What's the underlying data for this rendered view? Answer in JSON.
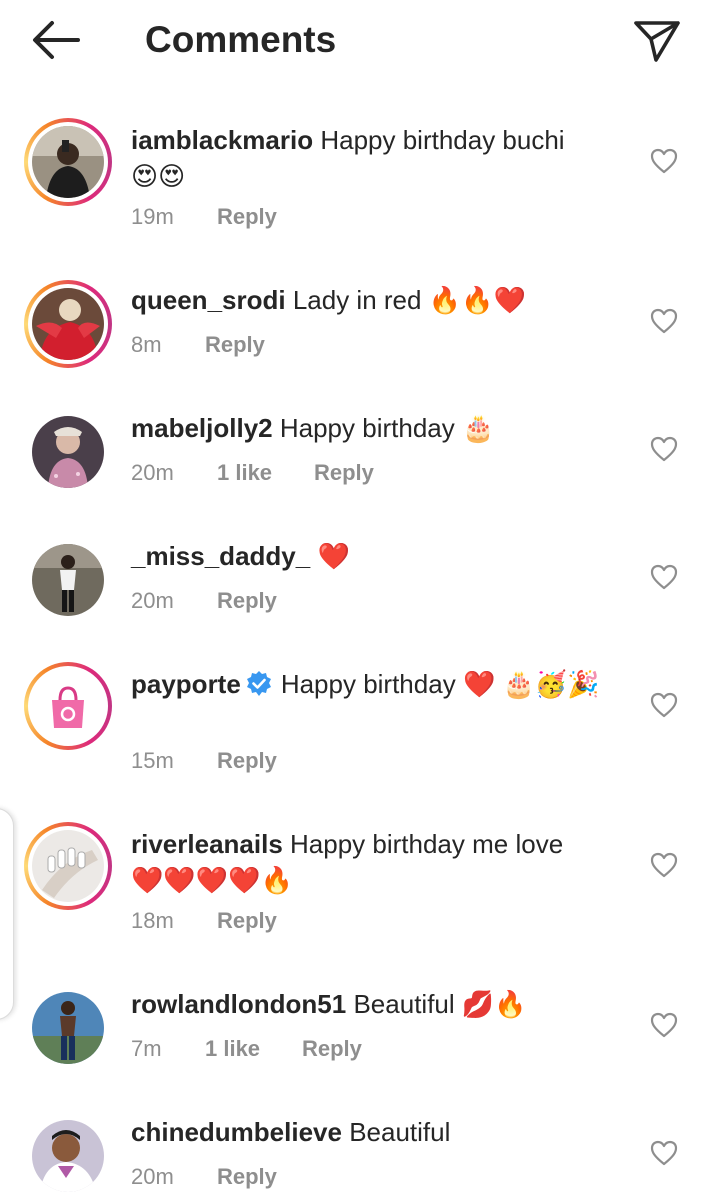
{
  "header": {
    "title": "Comments"
  },
  "comments": [
    {
      "username": "iamblackmario",
      "text": "Happy birthday buchi",
      "emojis": "😍😍",
      "time": "19m",
      "likes": "",
      "reply": "Reply"
    },
    {
      "username": "queen_srodi",
      "text": "Lady in red",
      "emojis": "🔥🔥❤️",
      "time": "8m",
      "likes": "",
      "reply": "Reply"
    },
    {
      "username": "mabeljolly2",
      "text": "Happy birthday",
      "emojis": "🎂",
      "time": "20m",
      "likes": "1 like",
      "reply": "Reply"
    },
    {
      "username": "_miss_daddy_",
      "text": "",
      "emojis": "❤️",
      "time": "20m",
      "likes": "",
      "reply": "Reply"
    },
    {
      "username": "payporte",
      "text": "Happy birthday",
      "emojis": "❤️ 🎂🥳🎉",
      "time": "15m",
      "likes": "",
      "reply": "Reply",
      "verified": true
    },
    {
      "username": "riverleanails",
      "text": "Happy birthday me love",
      "emojis": "❤️❤️❤️❤️🔥",
      "time": "18m",
      "likes": "",
      "reply": "Reply"
    },
    {
      "username": "rowlandlondon51",
      "text": "Beautiful",
      "emojis": "💋🔥",
      "time": "7m",
      "likes": "1 like",
      "reply": "Reply"
    },
    {
      "username": "chinedumbelieve",
      "text": "Beautiful",
      "emojis": "",
      "time": "20m",
      "likes": "",
      "reply": "Reply"
    }
  ],
  "icons": {
    "back": "arrow-left-icon",
    "send": "paper-plane-icon",
    "like": "heart-outline-icon",
    "verified": "verified-badge-icon"
  },
  "colors": {
    "text": "#262626",
    "meta": "#8e8e8e",
    "verified": "#3897f0",
    "story_ring_start": "#f58529",
    "story_ring_end": "#dd2a7b"
  }
}
